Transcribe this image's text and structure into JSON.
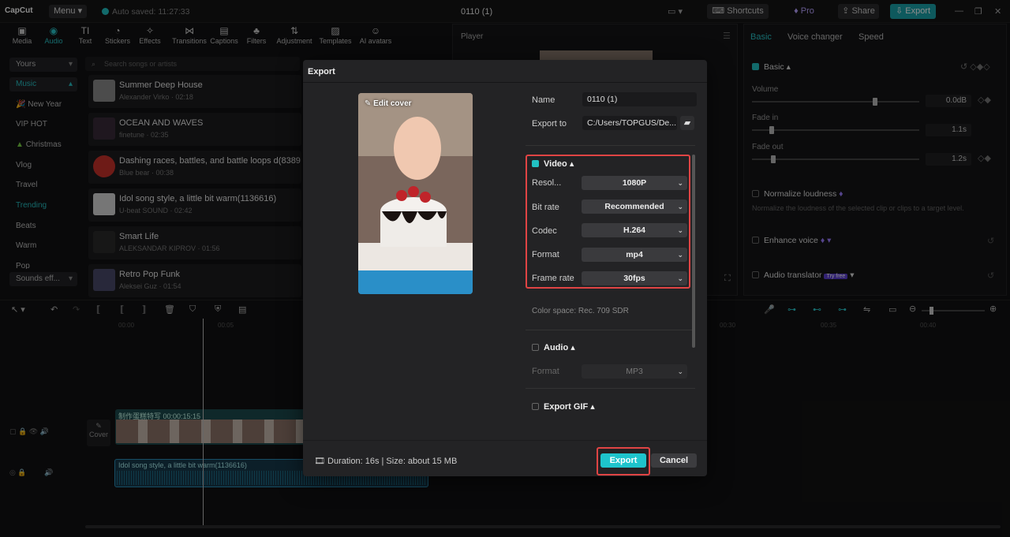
{
  "titlebar": {
    "logo": "CapCut",
    "menu": "Menu",
    "autosave": "Auto saved: 11:27:33",
    "project_title": "0110 (1)",
    "shortcuts": "Shortcuts",
    "pro": "Pro",
    "share": "Share",
    "export": "Export"
  },
  "media_toolbar": [
    {
      "label": "Media",
      "icon": "media-icon"
    },
    {
      "label": "Audio",
      "icon": "audio-icon"
    },
    {
      "label": "Text",
      "icon": "text-icon"
    },
    {
      "label": "Stickers",
      "icon": "stickers-icon"
    },
    {
      "label": "Effects",
      "icon": "effects-icon"
    },
    {
      "label": "Transitions",
      "icon": "transitions-icon"
    },
    {
      "label": "Captions",
      "icon": "captions-icon"
    },
    {
      "label": "Filters",
      "icon": "filters-icon"
    },
    {
      "label": "Adjustment",
      "icon": "adjustment-icon"
    },
    {
      "label": "Templates",
      "icon": "templates-icon"
    },
    {
      "label": "AI avatars",
      "icon": "ai-avatars-icon"
    }
  ],
  "categories": [
    {
      "label": "Yours"
    },
    {
      "label": "Music"
    },
    {
      "label": "New Year"
    },
    {
      "label": "VIP HOT"
    },
    {
      "label": "Christmas"
    },
    {
      "label": "Vlog"
    },
    {
      "label": "Travel"
    },
    {
      "label": "Trending"
    },
    {
      "label": "Beats"
    },
    {
      "label": "Warm"
    },
    {
      "label": "Pop"
    },
    {
      "label": "Sounds eff..."
    }
  ],
  "search_placeholder": "Search songs or artists",
  "songs": [
    {
      "title": "Summer Deep House",
      "meta": "Alexander Virko · 02:18"
    },
    {
      "title": "OCEAN AND WAVES",
      "meta": "finetune · 02:35"
    },
    {
      "title": "Dashing races, battles, and battle loops d(83894",
      "meta": "Blue bear · 00:38"
    },
    {
      "title": "Idol song style, a little bit warm(1136616)",
      "meta": "U-beat SOUND · 02:42"
    },
    {
      "title": "Smart Life",
      "meta": "ALEKSANDAR KIPROV · 01:56"
    },
    {
      "title": "Retro Pop Funk",
      "meta": "Aleksei Guz · 01:54"
    }
  ],
  "player": {
    "title": "Player"
  },
  "right_panel": {
    "tabs": [
      "Basic",
      "Voice changer",
      "Speed"
    ],
    "basic_label": "Basic",
    "volume_label": "Volume",
    "volume_value": "0.0dB",
    "fade_in_label": "Fade in",
    "fade_in_value": "1.1s",
    "fade_out_label": "Fade out",
    "fade_out_value": "1.2s",
    "normalize_label": "Normalize loudness",
    "normalize_note": "Normalize the loudness of the selected clip or clips to a target level.",
    "enhance_label": "Enhance voice",
    "translator_label": "Audio translator",
    "try_free": "Try free"
  },
  "timeline": {
    "ticks": [
      "00:00",
      "00:05",
      "00:30",
      "00:35",
      "00:40"
    ],
    "cover_label": "Cover",
    "video_clip_label": "制作蛋糕特写  00:00:15:15",
    "audio_clip_label": "Idol song style, a little bit warm(1136616)"
  },
  "dialog": {
    "title": "Export",
    "edit_cover": "Edit cover",
    "name_label": "Name",
    "name_value": "0110 (1)",
    "export_to_label": "Export to",
    "export_to_value": "C:/Users/TOPGUS/De...",
    "video_label": "Video",
    "resolution_label": "Resol...",
    "resolution_value": "1080P",
    "bitrate_label": "Bit rate",
    "bitrate_value": "Recommended",
    "codec_label": "Codec",
    "codec_value": "H.264",
    "format_label": "Format",
    "format_value": "mp4",
    "framerate_label": "Frame rate",
    "framerate_value": "30fps",
    "color_space": "Color space: Rec. 709 SDR",
    "audio_label": "Audio",
    "audio_format_label": "Format",
    "audio_format_value": "MP3",
    "gif_label": "Export GIF",
    "duration_size": "Duration: 16s | Size: about 15 MB",
    "export_btn": "Export",
    "cancel_btn": "Cancel"
  },
  "colors": {
    "accent": "#1ec4cc",
    "highlight": "#e04444"
  }
}
